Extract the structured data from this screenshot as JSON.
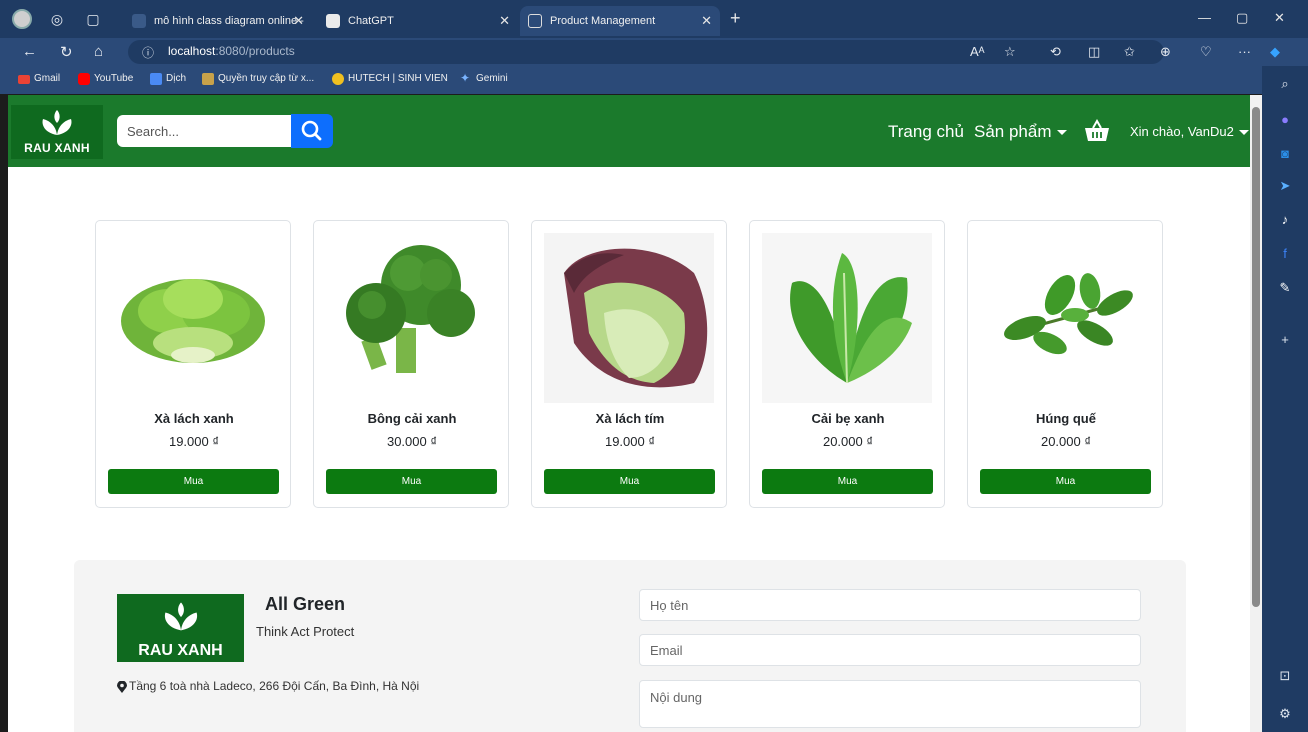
{
  "browser": {
    "tabs": [
      {
        "label": "mô hình class diagram online - T",
        "active": false
      },
      {
        "label": "ChatGPT",
        "active": false
      },
      {
        "label": "Product Management",
        "active": true
      }
    ],
    "url_host": "localhost",
    "url_path": ":8080/products",
    "bookmarks": [
      "Gmail",
      "YouTube",
      "Dịch",
      "Quyền truy cập từ x...",
      "HUTECH | SINH VIEN",
      "Gemini"
    ]
  },
  "header": {
    "logo_text": "RAU XANH",
    "search_placeholder": "Search...",
    "nav_home": "Trang chủ",
    "nav_products": "Sản phẩm",
    "greeting": "Xin chào, VanDu2"
  },
  "products": [
    {
      "name": "Xà lách xanh",
      "price": "19.000 ₫",
      "buy_label": "Mua"
    },
    {
      "name": "Bông cải xanh",
      "price": "30.000 ₫",
      "buy_label": "Mua"
    },
    {
      "name": "Xà lách tím",
      "price": "19.000 ₫",
      "buy_label": "Mua"
    },
    {
      "name": "Cải bẹ xanh",
      "price": "20.000 ₫",
      "buy_label": "Mua"
    },
    {
      "name": "Húng quế",
      "price": "20.000 ₫",
      "buy_label": "Mua"
    }
  ],
  "footer": {
    "logo_text": "RAU XANH",
    "title": "All Green",
    "slogan": "Think Act Protect",
    "address": "Tầng 6 toà nhà Ladeco, 266 Đội Cấn, Ba Đình, Hà Nội",
    "form": {
      "name_placeholder": "Họ tên",
      "email_placeholder": "Email",
      "content_placeholder": "Nội dung"
    }
  },
  "colors": {
    "navbar": "#1b7a2c",
    "button_buy": "#0c7a10",
    "search_button": "#0d6efd",
    "browser_frame": "#1f3b63"
  }
}
